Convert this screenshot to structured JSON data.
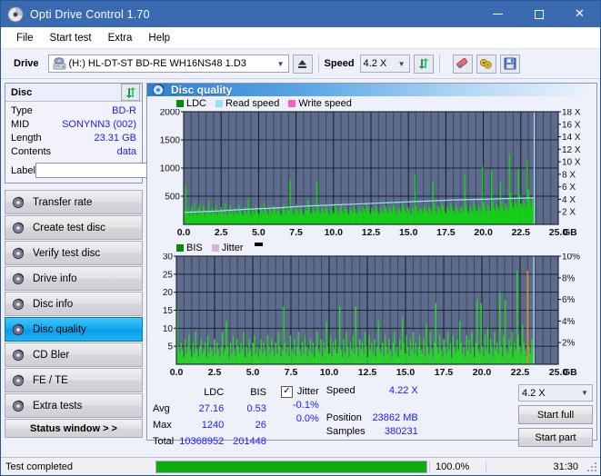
{
  "window": {
    "title": "Opti Drive Control 1.70",
    "icon": "disc-icon",
    "minimize": "—",
    "maximize": "□",
    "close": "✕"
  },
  "menu": {
    "items": [
      "File",
      "Start test",
      "Extra",
      "Help"
    ]
  },
  "toolbar": {
    "drive_label": "Drive",
    "drive_value": "(H:)  HL-DT-ST BD-RE  WH16NS48 1.D3",
    "eject_icon": "eject-icon",
    "speed_label": "Speed",
    "speed_value": "4.2 X",
    "refresh_icon": "refresh-icon",
    "erase_icon": "eraser-icon",
    "tools_icon": "tools-icon",
    "save_icon": "floppy-save-icon"
  },
  "disc": {
    "header": "Disc",
    "refresh_icon": "refresh-icon",
    "rows": [
      {
        "key": "Type",
        "value": "BD-R"
      },
      {
        "key": "MID",
        "value": "SONYNN3 (002)"
      },
      {
        "key": "Length",
        "value": "23.31 GB"
      },
      {
        "key": "Contents",
        "value": "data"
      }
    ],
    "label_key": "Label",
    "label_value": "",
    "label_placeholder": "",
    "disc_icon": "cd-disc-icon"
  },
  "nav": {
    "items": [
      {
        "label": "Transfer rate",
        "icon": "disc-icon",
        "selected": false
      },
      {
        "label": "Create test disc",
        "icon": "disc-icon",
        "selected": false
      },
      {
        "label": "Verify test disc",
        "icon": "disc-icon",
        "selected": false
      },
      {
        "label": "Drive info",
        "icon": "disc-icon",
        "selected": false
      },
      {
        "label": "Disc info",
        "icon": "disc-icon",
        "selected": false
      },
      {
        "label": "Disc quality",
        "icon": "disc-icon",
        "selected": true
      },
      {
        "label": "CD Bler",
        "icon": "disc-icon",
        "selected": false
      },
      {
        "label": "FE / TE",
        "icon": "disc-icon",
        "selected": false
      },
      {
        "label": "Extra tests",
        "icon": "disc-icon",
        "selected": false
      }
    ],
    "status_window": "Status window > >"
  },
  "panel": {
    "title": "Disc quality",
    "icon": "disc-quality-icon"
  },
  "stats": {
    "col_headers": [
      "LDC",
      "BIS"
    ],
    "row_labels": [
      "Avg",
      "Max",
      "Total"
    ],
    "ldc": [
      "27.16",
      "1240",
      "10368952"
    ],
    "bis": [
      "0.53",
      "26",
      "201448"
    ],
    "jitter_label": "Jitter",
    "jitter_checked": true,
    "jitter_values": [
      "-0.1%",
      "0.0%"
    ],
    "speed_label": "Speed",
    "speed_value": "4.22 X",
    "position_label": "Position",
    "position_value": "23862 MB",
    "samples_label": "Samples",
    "samples_value": "380231",
    "speed_select": "4.2 X",
    "start_full": "Start full",
    "start_part": "Start part"
  },
  "statusbar": {
    "text": "Test completed",
    "progress_pct": "100.0%",
    "progress_value": 100,
    "elapsed": "31:30"
  },
  "colors": {
    "accent": "#3a6ab0",
    "chart_bg": "#5d6c8c",
    "grid": "#232c3d",
    "ldc_green": "#14d214",
    "bis_green": "#2ad42a",
    "jitter_pink": "#d8b0d8",
    "read_speed": "#9fdcf8",
    "write_speed": "#ff5ad0",
    "value_blue": "#1a1aff",
    "progress_green": "#11aa11"
  },
  "chart_data": [
    {
      "type": "area",
      "name": "ldc-chart",
      "title": "",
      "xlabel": "GB",
      "ylabel": "",
      "legend": [
        {
          "label": "LDC",
          "color": "#0a8a0a"
        },
        {
          "label": "Read speed",
          "color": "#9fdcf8"
        },
        {
          "label": "Write speed",
          "color": "#ff5ad0"
        }
      ],
      "legend_position": "top-left",
      "grid": true,
      "xlim": [
        0,
        25.0
      ],
      "xticks": [
        "0.0",
        "2.5",
        "5.0",
        "7.5",
        "10.0",
        "12.5",
        "15.0",
        "17.5",
        "20.0",
        "22.5",
        "25.0"
      ],
      "ylim": [
        0,
        2000
      ],
      "yticks": [
        "2000",
        "1500",
        "1000",
        "500"
      ],
      "y2lim": [
        0,
        18
      ],
      "y2ticks": [
        "18 X",
        "16 X",
        "14 X",
        "12 X",
        "10 X",
        "8 X",
        "6 X",
        "4 X",
        "2 X"
      ],
      "data_end_x": 23.4,
      "series": [
        {
          "name": "LDC",
          "color": "#14d214",
          "values": [
            260,
            690,
            180,
            300,
            140,
            250,
            330,
            170,
            390,
            210,
            150,
            290,
            360,
            180,
            220,
            330,
            150,
            260,
            190,
            420,
            240,
            160,
            300,
            210,
            180,
            350,
            160,
            230,
            190,
            310,
            250,
            170,
            380,
            200,
            150,
            270,
            340,
            190,
            240,
            160,
            300,
            220,
            180,
            350,
            270,
            200,
            160,
            300,
            240,
            190,
            430,
            250,
            170,
            280,
            230,
            190,
            330,
            260,
            200,
            170,
            310,
            240,
            190,
            380,
            290,
            210,
            160,
            300,
            250,
            200,
            330,
            270,
            190,
            240,
            310,
            200,
            170,
            290,
            360,
            220,
            180,
            300,
            250,
            790,
            310,
            200,
            170,
            280,
            350,
            230,
            190,
            320,
            260,
            200,
            170,
            300,
            250,
            430,
            330,
            210,
            180,
            290,
            250,
            200,
            760,
            350,
            220,
            190,
            300,
            260,
            210,
            340,
            280,
            200,
            170,
            310,
            250,
            200,
            380,
            300,
            220,
            180,
            290,
            360,
            230,
            190,
            320,
            270,
            210,
            180,
            300,
            250,
            200,
            340,
            280,
            210,
            180,
            300,
            250,
            200,
            330,
            270,
            210,
            390,
            310,
            230,
            190,
            300,
            260,
            210,
            340,
            280,
            220,
            180,
            310,
            260,
            210,
            350,
            300,
            230,
            190,
            320,
            270,
            220,
            360,
            300,
            230,
            190,
            310,
            270,
            220,
            380,
            320,
            240,
            200,
            330,
            280,
            220,
            180,
            300,
            260,
            880,
            340,
            240,
            200,
            310,
            270,
            220,
            350,
            300,
            230,
            190,
            320,
            280,
            220,
            760,
            360,
            250,
            200,
            330,
            280,
            220,
            400,
            340,
            240,
            200,
            320,
            280,
            230,
            380,
            310,
            240,
            200,
            340,
            290,
            230,
            190,
            320,
            270,
            220,
            880,
            350,
            250,
            200,
            330,
            290,
            230,
            420,
            350,
            250,
            210,
            330,
            290,
            230,
            1030,
            400,
            280,
            220,
            350,
            300,
            240,
            960,
            420,
            290,
            230,
            360,
            310,
            250,
            760,
            400,
            300,
            240,
            370,
            320,
            260,
            1240,
            560,
            390,
            300,
            450,
            380,
            310,
            980,
            520,
            370,
            300,
            420,
            360,
            290,
            1150,
            620,
            420,
            320,
            470,
            400
          ]
        },
        {
          "name": "Read speed",
          "color": "#9fdcf8",
          "unit": "X",
          "points": [
            [
              0.0,
              1.9
            ],
            [
              2.0,
              2.1
            ],
            [
              4.0,
              2.4
            ],
            [
              6.0,
              2.6
            ],
            [
              8.0,
              2.9
            ],
            [
              10.0,
              3.1
            ],
            [
              12.0,
              3.3
            ],
            [
              14.0,
              3.5
            ],
            [
              16.0,
              3.7
            ],
            [
              18.0,
              3.9
            ],
            [
              20.0,
              4.0
            ],
            [
              22.0,
              4.15
            ],
            [
              23.4,
              4.22
            ]
          ]
        }
      ]
    },
    {
      "type": "area",
      "name": "bis-chart",
      "title": "",
      "xlabel": "GB",
      "ylabel": "",
      "legend": [
        {
          "label": "BIS",
          "color": "#0a8a0a"
        },
        {
          "label": "Jitter",
          "color": "#d8b0d8"
        }
      ],
      "legend_position": "top-left",
      "grid": true,
      "xlim": [
        0,
        25.0
      ],
      "xticks": [
        "0.0",
        "2.5",
        "5.0",
        "7.5",
        "10.0",
        "12.5",
        "15.0",
        "17.5",
        "20.0",
        "22.5",
        "25.0"
      ],
      "ylim": [
        0,
        30
      ],
      "yticks": [
        "30",
        "25",
        "20",
        "15",
        "10",
        "5"
      ],
      "y2lim": [
        0,
        10
      ],
      "y2ticks": [
        "10%",
        "8%",
        "6%",
        "4%",
        "2%"
      ],
      "data_end_x": 23.4,
      "series": [
        {
          "name": "BIS",
          "color": "#2ad42a",
          "values": [
            15,
            5,
            3,
            6,
            4,
            2,
            7,
            3,
            5,
            8,
            4,
            2,
            6,
            3,
            9,
            4,
            2,
            5,
            7,
            3,
            4,
            6,
            2,
            8,
            3,
            5,
            4,
            2,
            7,
            3,
            6,
            4,
            2,
            5,
            9,
            3,
            4,
            12,
            5,
            2,
            6,
            3,
            8,
            4,
            2,
            7,
            5,
            3,
            6,
            4,
            9,
            2,
            5,
            3,
            7,
            4,
            2,
            6,
            8,
            3,
            5,
            2,
            4,
            7,
            3,
            6,
            4,
            2,
            8,
            5,
            3,
            7,
            4,
            2,
            6,
            3,
            9,
            5,
            2,
            4,
            16,
            6,
            3,
            5,
            2,
            8,
            4,
            3,
            7,
            2,
            5,
            9,
            4,
            2,
            6,
            3,
            8,
            5,
            2,
            4,
            7,
            3,
            6,
            2,
            5,
            9,
            4,
            3,
            7,
            2,
            6,
            4,
            12,
            5,
            3,
            8,
            2,
            6,
            4,
            7,
            3,
            5,
            16,
            4,
            2,
            7,
            3,
            9,
            5,
            2,
            6,
            4,
            8,
            3,
            16,
            5,
            2,
            7,
            4,
            6,
            3,
            9,
            5,
            2,
            8,
            4,
            6,
            3,
            7,
            2,
            5,
            12,
            4,
            3,
            6,
            2,
            8,
            5,
            3,
            7,
            4,
            2,
            6,
            9,
            3,
            5,
            2,
            7,
            4,
            13,
            6,
            3,
            8,
            5,
            2,
            7,
            4,
            9,
            3,
            6,
            2,
            5,
            8,
            4,
            3,
            7,
            2,
            11,
            5,
            3,
            9,
            4,
            2,
            6,
            17,
            5,
            3,
            8,
            4,
            2,
            7,
            5,
            3,
            9,
            4,
            6,
            2,
            8,
            5,
            3,
            7,
            4,
            12,
            6,
            3,
            5,
            2,
            8,
            4,
            7,
            3,
            9,
            5,
            2,
            6,
            18,
            4,
            3,
            17,
            5,
            2,
            8,
            4,
            10,
            3,
            7,
            5,
            2,
            9,
            4,
            6,
            3,
            20,
            5,
            2,
            8,
            18,
            4,
            3,
            7,
            5,
            9,
            2,
            6,
            4,
            26,
            8,
            5,
            3,
            11,
            6,
            4,
            2,
            9,
            5,
            3,
            7,
            4
          ]
        },
        {
          "name": "Jitter",
          "color": "#d8b0d8",
          "unit": "%",
          "note": "flat near 0 across the scan; orange spike near 22.9 GB"
        }
      ]
    }
  ]
}
